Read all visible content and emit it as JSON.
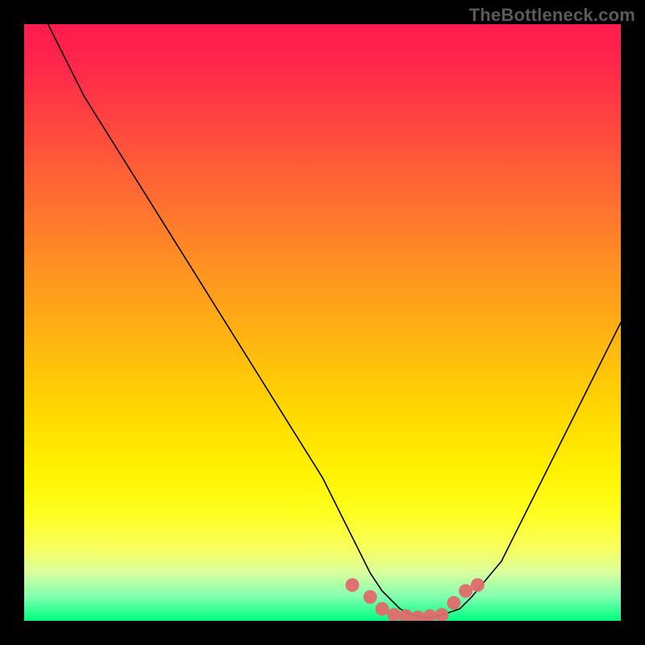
{
  "watermark": "TheBottleneck.com",
  "colors": {
    "background": "#000000",
    "curve": "#000000",
    "marker_fill": "#e26a6a",
    "watermark": "#5a5a5a"
  },
  "chart_data": {
    "type": "line",
    "title": "",
    "xlabel": "",
    "ylabel": "",
    "xlim": [
      0,
      100
    ],
    "ylim": [
      0,
      100
    ],
    "grid": false,
    "legend": false,
    "series": [
      {
        "name": "bottleneck-curve",
        "x": [
          4,
          10,
          20,
          30,
          40,
          50,
          55,
          58,
          60,
          63,
          65,
          68,
          70,
          73,
          75,
          80,
          85,
          90,
          95,
          100
        ],
        "y": [
          100,
          88,
          72,
          56,
          40,
          24,
          14,
          8,
          5,
          2,
          1,
          0.5,
          1,
          2,
          4,
          10,
          20,
          30,
          40,
          50
        ]
      }
    ],
    "markers": {
      "name": "minimum-band",
      "x": [
        55,
        58,
        60,
        62,
        64,
        66,
        68,
        70,
        72,
        74,
        76
      ],
      "y": [
        6,
        4,
        2,
        1,
        0.8,
        0.6,
        0.8,
        1,
        3,
        5,
        6
      ]
    }
  }
}
